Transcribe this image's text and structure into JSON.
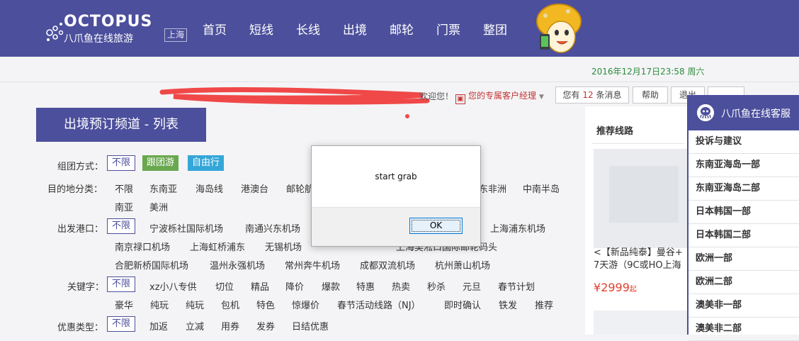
{
  "header": {
    "logo_text": "OCTOPUS",
    "logo_cn": "八爪鱼在线旅游",
    "city": "上海",
    "nav": [
      "首页",
      "短线",
      "长线",
      "出境",
      "邮轮",
      "门票",
      "整团"
    ]
  },
  "topbar": {
    "date": "2016年12月17日23:58 周六",
    "welcome": "欢迎您！",
    "manager": "您的专属客户经理",
    "messages_prefix": "您有",
    "messages_count": "12",
    "messages_suffix": "条消息",
    "help": "帮助",
    "logout": "退出"
  },
  "page_title": "出境预订频道 - 列表",
  "filters": {
    "group": {
      "label": "组团方式：",
      "selected": "不限",
      "options": [
        "跟团游",
        "自由行"
      ]
    },
    "destination": {
      "label": "目的地分类：",
      "options": [
        "不限",
        "东南亚",
        "海岛线",
        "港澳台",
        "邮轮航",
        "东非洲",
        "中南半岛"
      ],
      "options2": [
        "南亚",
        "美洲"
      ]
    },
    "port": {
      "label": "出发港口：",
      "selected": "不限",
      "row1": [
        "宁波栎社国际机场",
        "南通兴东机场",
        "上海浦东机场"
      ],
      "row2": [
        "南京禄口机场",
        "上海虹桥浦东",
        "无锡机场",
        "上海吴淞口国际邮轮码头"
      ],
      "row3": [
        "合肥新桥国际机场",
        "温州永强机场",
        "常州奔牛机场",
        "成都双流机场",
        "杭州萧山机场"
      ]
    },
    "keyword": {
      "label": "关键字：",
      "selected": "不限",
      "row1": [
        "xz小八专供",
        "切位",
        "精品",
        "降价",
        "爆款",
        "特惠",
        "热卖",
        "秒杀",
        "元旦",
        "春节计划"
      ],
      "row2": [
        "豪华",
        "纯玩",
        "纯玩",
        "包机",
        "特色",
        "惊爆价",
        "春节活动线路（NJ）",
        "即时确认",
        "铁发",
        "推荐"
      ]
    },
    "discount": {
      "label": "优惠类型：",
      "selected": "不限",
      "options": [
        "加返",
        "立减",
        "用券",
        "发券",
        "日结优惠"
      ]
    }
  },
  "recommend": {
    "title": "推荐线路",
    "item_title_1": "<【新品纯泰】曼谷+",
    "item_title_2": "7天游（9C或HO上海",
    "price_symbol": "¥",
    "price": "2999",
    "price_suffix": "起"
  },
  "service": {
    "title": "八爪鱼在线客服",
    "items": [
      "投诉与建议",
      "东南亚海岛一部",
      "东南亚海岛二部",
      "日本韩国一部",
      "日本韩国二部",
      "欧洲一部",
      "欧洲二部",
      "澳美非一部",
      "澳美非二部"
    ]
  },
  "dialog": {
    "message": "start grab",
    "ok": "OK"
  },
  "colors": {
    "brand": "#4c4f9c",
    "green_tag": "#6aa84f",
    "blue_tag": "#35a6d8",
    "price": "#e33e2e",
    "date": "#2e8b3d"
  }
}
